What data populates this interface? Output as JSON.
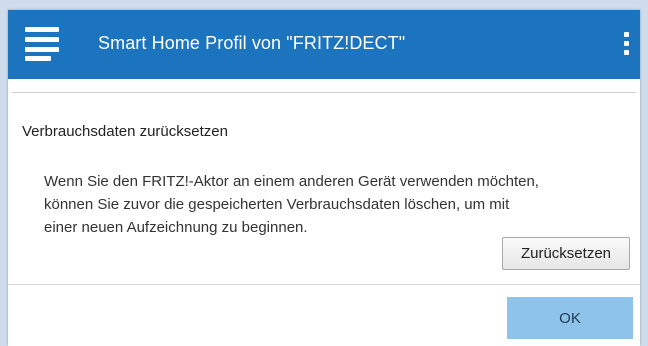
{
  "colors": {
    "header_bg": "#1c73be",
    "header_text": "#ffffff",
    "ok_button_bg": "#8fc4ea",
    "page_background": "#cfdcec"
  },
  "header": {
    "menu_icon": "hamburger-menu-icon",
    "title": "Smart Home Profil von \"FRITZ!DECT\"",
    "more_icon": "vertical-dots-icon"
  },
  "section": {
    "heading": "Verbrauchsdaten zurücksetzen",
    "description_lines": [
      "Wenn Sie den FRITZ!-Aktor an einem anderen Gerät verwenden möchten,",
      "können Sie zuvor die gespeicherten Verbrauchsdaten löschen, um mit",
      "einer neuen Aufzeichnung zu beginnen."
    ],
    "reset_button_label": "Zurücksetzen"
  },
  "footer": {
    "ok_label": "OK"
  }
}
